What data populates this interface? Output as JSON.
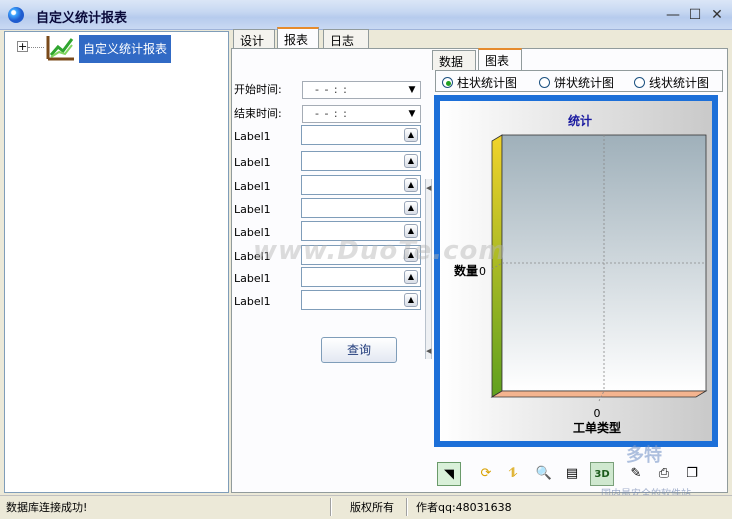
{
  "window": {
    "title": "自定义统计报表"
  },
  "tree": {
    "root_label": "自定义统计报表",
    "expander": "+"
  },
  "tabs": [
    {
      "label": "设计",
      "active": false
    },
    {
      "label": "报表",
      "active": true
    },
    {
      "label": "日志",
      "active": false
    }
  ],
  "form": {
    "start_label": "开始时间:",
    "end_label": "结束时间:",
    "start_value": "- -    : :",
    "end_value": "- -    : :",
    "fields": [
      {
        "label": "Label1"
      },
      {
        "label": "Label1"
      },
      {
        "label": "Label1"
      },
      {
        "label": "Label1"
      },
      {
        "label": "Label1"
      },
      {
        "label": "Label1"
      },
      {
        "label": "Label1"
      },
      {
        "label": "Label1"
      }
    ],
    "query_button": "查询"
  },
  "sub_tabs": [
    {
      "label": "数据",
      "active": false
    },
    {
      "label": "图表",
      "active": true
    }
  ],
  "chart_types": [
    {
      "label": "柱状统计图",
      "selected": true
    },
    {
      "label": "饼状统计图",
      "selected": false
    },
    {
      "label": "线状统计图",
      "selected": false
    }
  ],
  "chart_data": {
    "type": "bar",
    "title": "统计",
    "xlabel": "工单类型",
    "ylabel": "数量",
    "categories": [],
    "values": [],
    "x_tick_labels": [
      "0"
    ],
    "y_tick_labels": [
      "0"
    ],
    "grid": true,
    "three_d": true,
    "colors": {
      "title": "#1a1aa0",
      "frame": "#1c6fd8",
      "wall_left": "#c9d636",
      "floor": "#f4b48f"
    }
  },
  "toolbar": {
    "buttons": [
      {
        "icon": "pointer-icon"
      },
      {
        "icon": "rotate-icon"
      },
      {
        "icon": "move-icon"
      },
      {
        "icon": "zoom-icon"
      },
      {
        "icon": "depth-icon"
      },
      {
        "icon": "3d-icon",
        "label": "3D"
      },
      {
        "icon": "edit-icon"
      },
      {
        "icon": "print-icon"
      },
      {
        "icon": "copy-icon"
      }
    ]
  },
  "watermark": {
    "text": "www.DuoTe.com",
    "logo": "多特",
    "logo_sub": "国内最安全的软件站"
  },
  "status": {
    "message": "数据库连接成功!",
    "copyright": "版权所有",
    "author": "作者qq:48031638"
  },
  "colors": {
    "accent": "#316ac5",
    "tab_highlight": "#e68b2c"
  }
}
